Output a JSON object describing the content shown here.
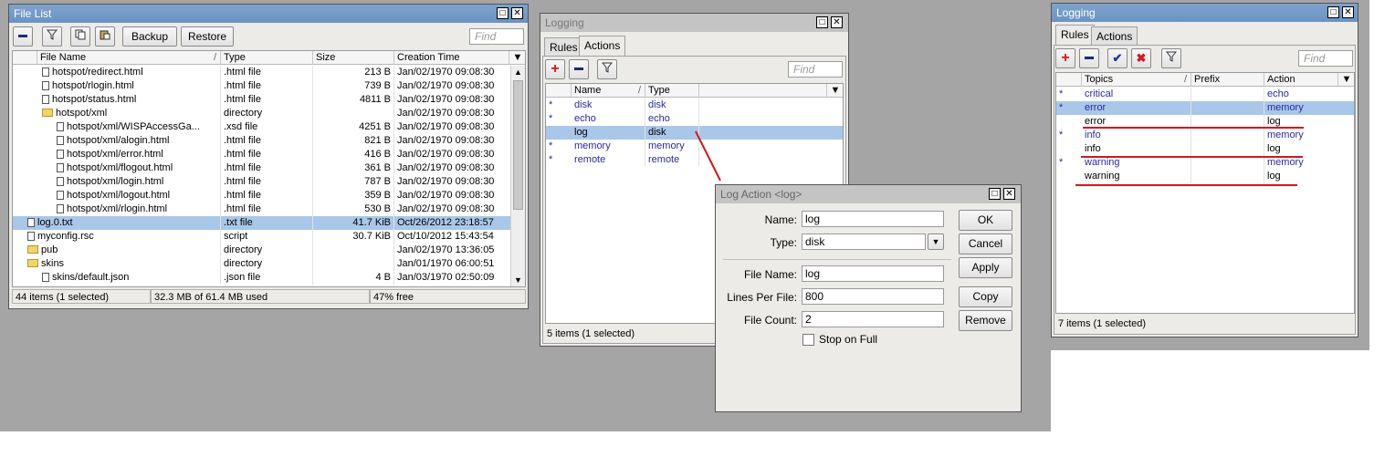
{
  "file_list": {
    "title": "File List",
    "toolbar": {
      "backup_label": "Backup",
      "restore_label": "Restore",
      "find_placeholder": "Find"
    },
    "columns": [
      "File Name",
      "Type",
      "Size",
      "Creation Time"
    ],
    "rows": [
      {
        "name": "hotspot/redirect.html",
        "type": ".html file",
        "size": "213 B",
        "time": "Jan/02/1970 09:08:30",
        "kind": "file",
        "indent": 2
      },
      {
        "name": "hotspot/rlogin.html",
        "type": ".html file",
        "size": "739 B",
        "time": "Jan/02/1970 09:08:30",
        "kind": "file",
        "indent": 2
      },
      {
        "name": "hotspot/status.html",
        "type": ".html file",
        "size": "4811 B",
        "time": "Jan/02/1970 09:08:30",
        "kind": "file",
        "indent": 2
      },
      {
        "name": "hotspot/xml",
        "type": "directory",
        "size": "",
        "time": "Jan/02/1970 09:08:30",
        "kind": "folder",
        "indent": 2
      },
      {
        "name": "hotspot/xml/WISPAccessGa...",
        "type": ".xsd file",
        "size": "4251 B",
        "time": "Jan/02/1970 09:08:30",
        "kind": "file",
        "indent": 3
      },
      {
        "name": "hotspot/xml/alogin.html",
        "type": ".html file",
        "size": "821 B",
        "time": "Jan/02/1970 09:08:30",
        "kind": "file",
        "indent": 3
      },
      {
        "name": "hotspot/xml/error.html",
        "type": ".html file",
        "size": "416 B",
        "time": "Jan/02/1970 09:08:30",
        "kind": "file",
        "indent": 3
      },
      {
        "name": "hotspot/xml/flogout.html",
        "type": ".html file",
        "size": "361 B",
        "time": "Jan/02/1970 09:08:30",
        "kind": "file",
        "indent": 3
      },
      {
        "name": "hotspot/xml/login.html",
        "type": ".html file",
        "size": "787 B",
        "time": "Jan/02/1970 09:08:30",
        "kind": "file",
        "indent": 3
      },
      {
        "name": "hotspot/xml/logout.html",
        "type": ".html file",
        "size": "359 B",
        "time": "Jan/02/1970 09:08:30",
        "kind": "file",
        "indent": 3
      },
      {
        "name": "hotspot/xml/rlogin.html",
        "type": ".html file",
        "size": "530 B",
        "time": "Jan/02/1970 09:08:30",
        "kind": "file",
        "indent": 3
      },
      {
        "name": "log.0.txt",
        "type": ".txt file",
        "size": "41.7 KiB",
        "time": "Oct/26/2012 23:18:57",
        "kind": "file",
        "indent": 1,
        "selected": true
      },
      {
        "name": "myconfig.rsc",
        "type": "script",
        "size": "30.7 KiB",
        "time": "Oct/10/2012 15:43:54",
        "kind": "file",
        "indent": 1
      },
      {
        "name": "pub",
        "type": "directory",
        "size": "",
        "time": "Jan/02/1970 13:36:05",
        "kind": "folder",
        "indent": 1
      },
      {
        "name": "skins",
        "type": "directory",
        "size": "",
        "time": "Jan/01/1970 06:00:51",
        "kind": "folder",
        "indent": 1
      },
      {
        "name": "skins/default.json",
        "type": ".json file",
        "size": "4 B",
        "time": "Jan/03/1970 02:50:09",
        "kind": "file",
        "indent": 2
      }
    ],
    "status": {
      "items": "44 items (1 selected)",
      "used": "32.3 MB of 61.4 MB used",
      "free": "47% free"
    }
  },
  "logging_actions": {
    "title": "Logging",
    "tabs": [
      "Rules",
      "Actions"
    ],
    "find_placeholder": "Find",
    "columns": [
      "Name",
      "Type"
    ],
    "rows": [
      {
        "mark": "*",
        "name": "disk",
        "type": "disk"
      },
      {
        "mark": "*",
        "name": "echo",
        "type": "echo"
      },
      {
        "mark": "",
        "name": "log",
        "type": "disk",
        "selected": true
      },
      {
        "mark": "*",
        "name": "memory",
        "type": "memory"
      },
      {
        "mark": "*",
        "name": "remote",
        "type": "remote"
      }
    ],
    "status": "5 items (1 selected)"
  },
  "log_action": {
    "title": "Log Action <log>",
    "name_label": "Name:",
    "name_value": "log",
    "type_label": "Type:",
    "type_value": "disk",
    "file_name_label": "File Name:",
    "file_name_value": "log",
    "lines_label": "Lines Per File:",
    "lines_value": "800",
    "count_label": "File Count:",
    "count_value": "2",
    "stop_label": "Stop on Full",
    "buttons": {
      "ok": "OK",
      "cancel": "Cancel",
      "apply": "Apply",
      "copy": "Copy",
      "remove": "Remove"
    }
  },
  "logging_rules": {
    "title": "Logging",
    "tabs": [
      "Rules",
      "Actions"
    ],
    "find_placeholder": "Find",
    "columns": [
      "Topics",
      "Prefix",
      "Action"
    ],
    "rows": [
      {
        "mark": "*",
        "topic": "critical",
        "prefix": "",
        "action": "echo",
        "blue": true
      },
      {
        "mark": "*",
        "topic": "error",
        "prefix": "",
        "action": "memory",
        "blue": true,
        "selected": true
      },
      {
        "mark": "",
        "topic": "error",
        "prefix": "",
        "action": "log",
        "blue": false
      },
      {
        "mark": "*",
        "topic": "info",
        "prefix": "",
        "action": "memory",
        "blue": true
      },
      {
        "mark": "",
        "topic": "info",
        "prefix": "",
        "action": "log",
        "blue": false
      },
      {
        "mark": "*",
        "topic": "warning",
        "prefix": "",
        "action": "memory",
        "blue": true
      },
      {
        "mark": "",
        "topic": "warning",
        "prefix": "",
        "action": "log",
        "blue": false
      }
    ],
    "status": "7 items (1 selected)"
  },
  "colors": {
    "titlebar": "#6b93c2",
    "selected_row": "#a9c7e8",
    "annotation": "#d4161d",
    "desktop": "#a5a5a5"
  }
}
